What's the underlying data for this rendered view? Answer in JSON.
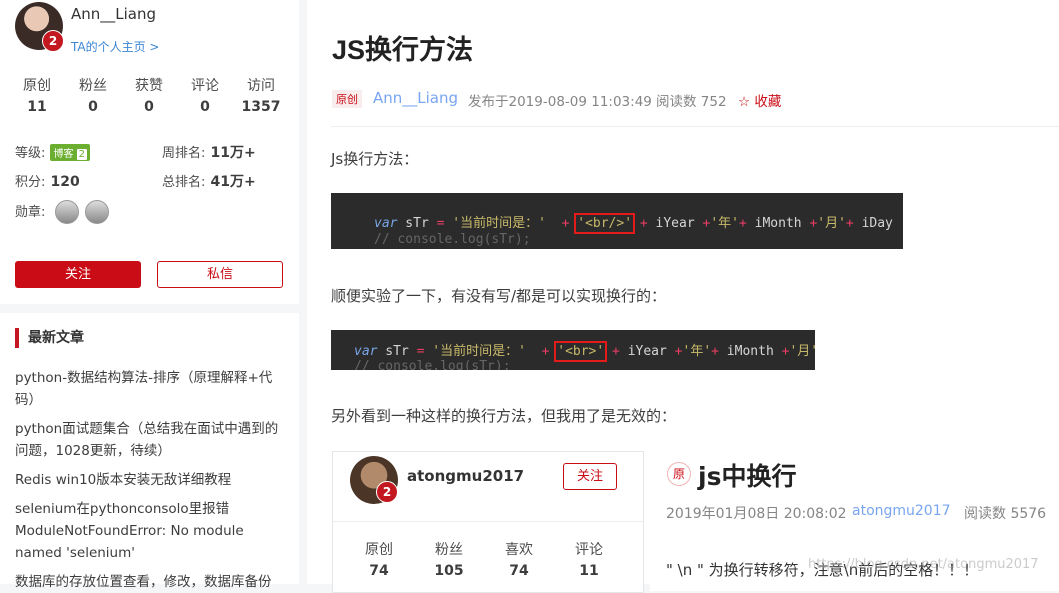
{
  "profile": {
    "username": "Ann__Liang",
    "home_link": "TA的个人主页 >",
    "stats": [
      {
        "label": "原创",
        "value": "11"
      },
      {
        "label": "粉丝",
        "value": "0"
      },
      {
        "label": "获赞",
        "value": "0"
      },
      {
        "label": "评论",
        "value": "0"
      },
      {
        "label": "访问",
        "value": "1357"
      }
    ],
    "level_label": "等级:",
    "level_badge": "博客",
    "level_num": "2",
    "week_rank_label": "周排名:",
    "week_rank": "11万+",
    "points_label": "积分:",
    "points": "120",
    "total_rank_label": "总排名:",
    "total_rank": "41万+",
    "medal_label": "勋章:",
    "follow_btn": "关注",
    "message_btn": "私信"
  },
  "recent": {
    "title": "最新文章",
    "items": [
      "python-数据结构算法-排序（原理解释+代码）",
      "python面试题集合（总结我在面试中遇到的问题，1028更新，待续）",
      "Redis win10版本安装无敌详细教程",
      "selenium在pythonconsolo里报错 ModuleNotFoundError: No module named 'selenium'",
      "数据库的存放位置查看，修改，数据库备份"
    ]
  },
  "article": {
    "title": "JS换行方法",
    "tag": "原创",
    "author": "Ann__Liang",
    "published": "发布于2019-08-09 11:03:49",
    "reads": "阅读数 752",
    "collect": "收藏",
    "p1": "Js换行方法：",
    "code1": {
      "kw": "var",
      "var": " sTr ",
      "eq": "=",
      "s1": " '当前时间是：' ",
      "plus": "+",
      "br": "'<br/>'",
      "rest_a": " iYear ",
      "s_year": "'年'",
      "rest_b": " iMonth ",
      "s_month": "'月'",
      "rest_c": " iDay",
      "comment": "// console.log(sTr);"
    },
    "p2": "顺便实验了一下，有没有写/都是可以实现换行的：",
    "code2": {
      "kw": "var",
      "var": " sTr ",
      "eq": "=",
      "s1": " '当前时间是：' ",
      "plus": "+",
      "br": "'<br>'",
      "rest_a": " iYear ",
      "s_year": "'年'",
      "rest_b": " iMonth ",
      "s_month": "'月'",
      "comment": "// console.log(sTr);"
    },
    "p3": "另外看到一种这样的换行方法，但我用了是无效的："
  },
  "embed": {
    "username": "atongmu2017",
    "follow": "关注",
    "stats": [
      {
        "label": "原创",
        "value": "74"
      },
      {
        "label": "粉丝",
        "value": "105"
      },
      {
        "label": "喜欢",
        "value": "74"
      },
      {
        "label": "评论",
        "value": "11"
      }
    ],
    "tag": "原",
    "title": "js中换行",
    "date": "2019年01月08日 20:08:02",
    "author": "atongmu2017",
    "reads": "阅读数 5576",
    "body": "\" \\n \" 为换行转移符，注意\\n前后的空格！！！",
    "watermark": "https://blog.csdn.net/atongmu2017"
  },
  "colors": {
    "brand": "#ca0c16",
    "link": "#3b86d4"
  }
}
